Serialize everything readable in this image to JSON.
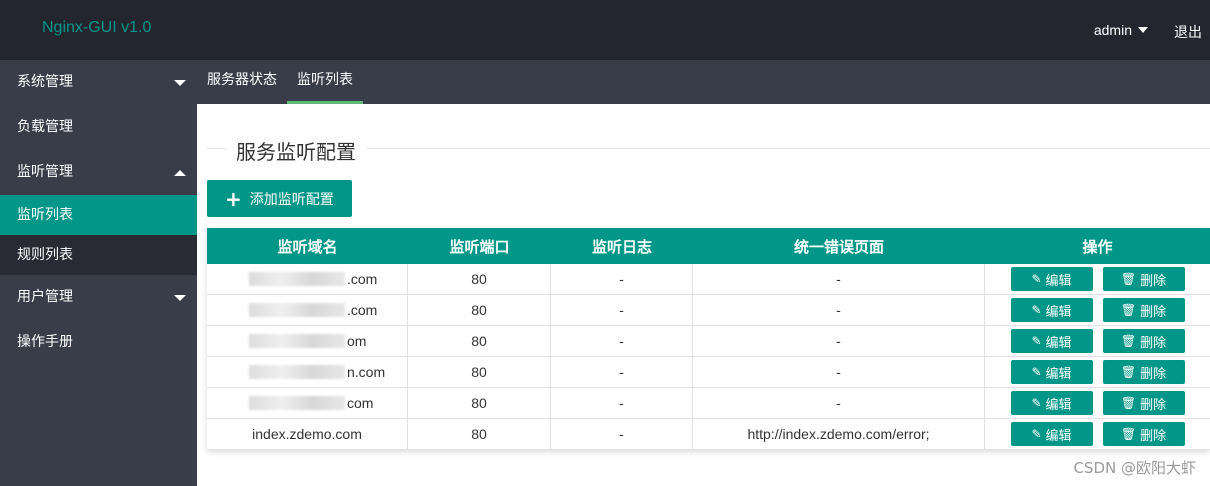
{
  "header": {
    "logo": "Nginx-GUI v1.0",
    "user": "admin",
    "logout": "退出"
  },
  "sidebar": {
    "items": [
      {
        "label": "系统管理"
      },
      {
        "label": "负载管理"
      },
      {
        "label": "监听管理"
      },
      {
        "label": "用户管理"
      },
      {
        "label": "操作手册"
      }
    ],
    "sub_items": [
      {
        "label": "监听列表"
      },
      {
        "label": "规则列表"
      }
    ]
  },
  "tabs": [
    {
      "label": "服务器状态"
    },
    {
      "label": "监听列表"
    }
  ],
  "main": {
    "section_title": "服务监听配置",
    "add_button": "添加监听配置",
    "table": {
      "headers": [
        "监听域名",
        "监听端口",
        "监听日志",
        "统一错误页面",
        "操作"
      ],
      "rows": [
        {
          "domain": ".com",
          "port": "80",
          "log": "-",
          "error_page": "-"
        },
        {
          "domain": ".com",
          "port": "80",
          "log": "-",
          "error_page": "-"
        },
        {
          "domain": "om",
          "port": "80",
          "log": "-",
          "error_page": "-"
        },
        {
          "domain": "n.com",
          "port": "80",
          "log": "-",
          "error_page": "-"
        },
        {
          "domain": "com",
          "port": "80",
          "log": "-",
          "error_page": "-"
        },
        {
          "domain": "index.zdemo.com",
          "port": "80",
          "log": "-",
          "error_page": "http://index.zdemo.com/error;"
        }
      ],
      "edit_label": "编辑",
      "delete_label": "删除"
    }
  },
  "watermark": "CSDN @欧阳大虾",
  "colors": {
    "accent": "#009688",
    "header_bg": "#23262e",
    "sidebar_bg": "#393d49",
    "tab_underline": "#5fb878"
  },
  "icons": {
    "edit": "edit-icon",
    "delete": "trash-icon"
  }
}
